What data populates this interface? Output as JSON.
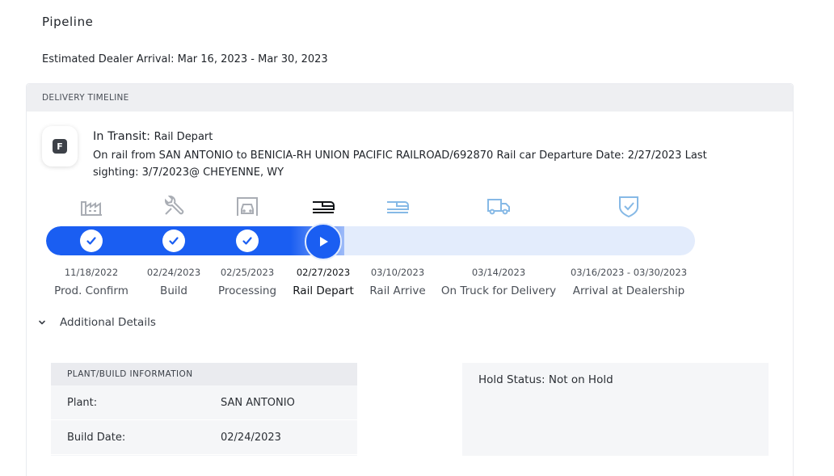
{
  "page": {
    "title": "Pipeline",
    "eta_text": "Estimated Dealer Arrival: Mar 16, 2023 - Mar 30, 2023"
  },
  "timeline": {
    "header": "DELIVERY TIMELINE",
    "status_badge_letter": "F",
    "status_title": "In Transit:",
    "status_subtitle": "Rail Depart",
    "status_description": "On rail from SAN ANTONIO to BENICIA-RH UNION PACIFIC RAILROAD/692870 Rail car Departure Date: 2/27/2023 Last sighting: 3/7/2023@ CHEYENNE, WY",
    "progress_fraction": 0.46,
    "stages": [
      {
        "label": "Prod. Confirm",
        "date": "11/18/2022",
        "icon": "factory-icon",
        "state": "complete"
      },
      {
        "label": "Build",
        "date": "02/24/2023",
        "icon": "wrench-icon",
        "state": "complete"
      },
      {
        "label": "Processing",
        "date": "02/25/2023",
        "icon": "car-bay-icon",
        "state": "complete"
      },
      {
        "label": "Rail Depart",
        "date": "02/27/2023",
        "icon": "train-icon",
        "state": "current"
      },
      {
        "label": "Rail Arrive",
        "date": "03/10/2023",
        "icon": "train-icon",
        "state": "upcoming"
      },
      {
        "label": "On Truck for Delivery",
        "date": "03/14/2023",
        "icon": "truck-icon",
        "state": "upcoming"
      },
      {
        "label": "Arrival at Dealership",
        "date": "03/16/2023 - 03/30/2023",
        "icon": "shield-check-icon",
        "state": "upcoming"
      }
    ]
  },
  "details": {
    "toggle_label": "Additional Details",
    "plant_info": {
      "header": "PLANT/BUILD INFORMATION",
      "rows": [
        {
          "key": "Plant:",
          "value": "SAN ANTONIO"
        },
        {
          "key": "Build Date:",
          "value": "02/24/2023"
        }
      ]
    },
    "hold_status": "Hold Status: Not on Hold"
  },
  "colors": {
    "accent": "#1a5ef2",
    "track_bg": "#e3ecfc",
    "icon_done": "#a9adb4",
    "icon_upcoming": "#86b9e6",
    "icon_current": "#111418"
  }
}
